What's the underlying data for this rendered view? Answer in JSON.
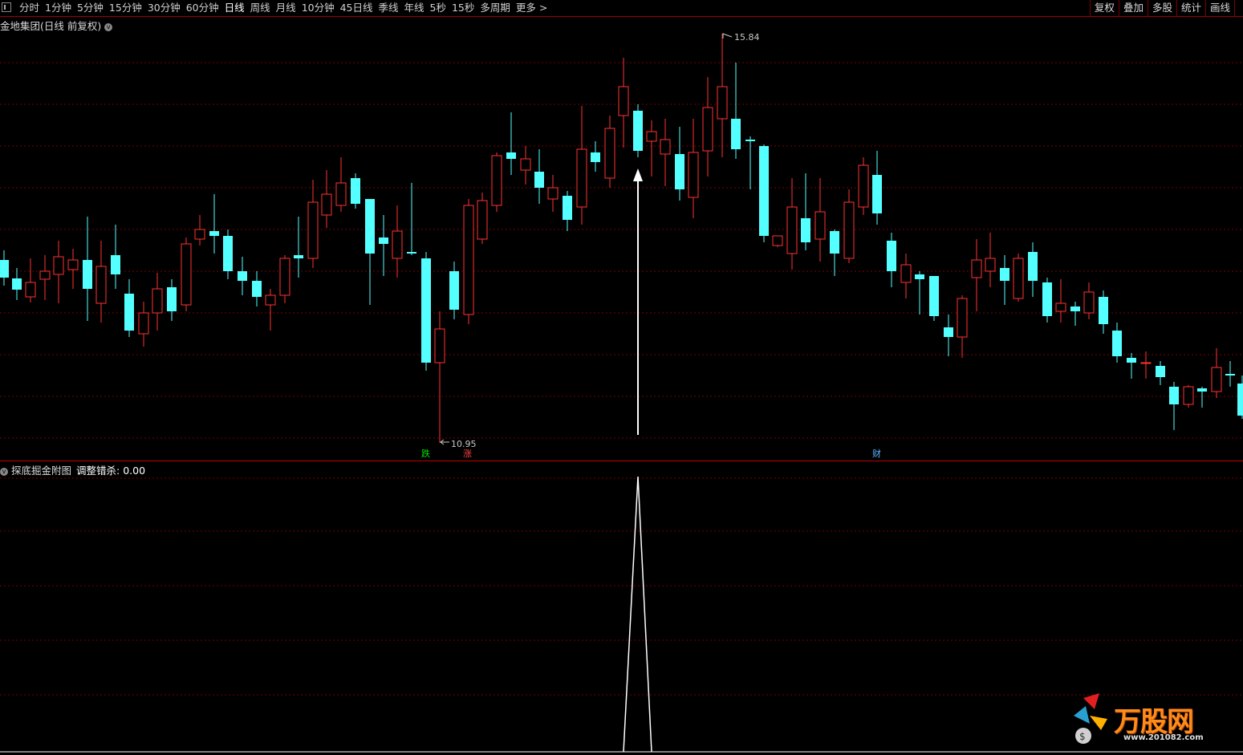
{
  "toolbar": {
    "periods": [
      "分时",
      "1分钟",
      "5分钟",
      "15分钟",
      "30分钟",
      "60分钟",
      "日线",
      "周线",
      "月线",
      "10分钟",
      "45日线",
      "季线",
      "年线",
      "5秒",
      "15秒",
      "多周期",
      "更多 >"
    ],
    "active_period": "日线",
    "right_tools": [
      "复权",
      "叠加",
      "多股",
      "统计",
      "画线"
    ]
  },
  "main_title": "金地集团(日线 前复权)",
  "sub_title": "探底掘金附图",
  "sub_indicator_label": "调整错杀: 0.00",
  "high_label": "15.84",
  "low_label": "10.95",
  "tags": {
    "die": "跌",
    "zhang": "涨",
    "cai": "财"
  },
  "colors": {
    "up": "#ff3232",
    "down": "#54ffff",
    "grid": "#7a0000",
    "divider": "#c00000"
  },
  "watermark": {
    "text": "万股网",
    "url": "www.201082.com"
  }
}
